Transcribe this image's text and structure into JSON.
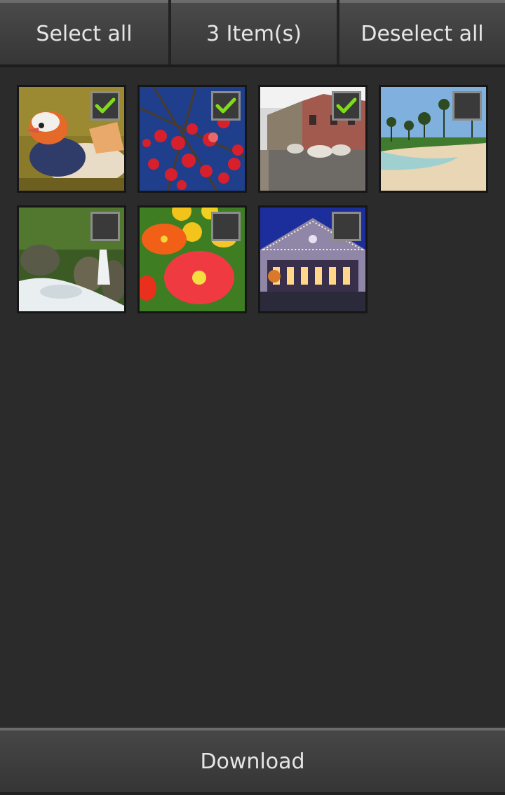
{
  "toolbar": {
    "select_all_label": "Select all",
    "count_label": "3 Item(s)",
    "deselect_all_label": "Deselect all"
  },
  "photos": [
    {
      "subject": "mandarin duck",
      "checked": true
    },
    {
      "subject": "red apples on branch",
      "checked": true
    },
    {
      "subject": "street with cattle",
      "checked": true
    },
    {
      "subject": "tropical beach",
      "checked": false
    },
    {
      "subject": "forest waterfall",
      "checked": false
    },
    {
      "subject": "red poppies",
      "checked": false
    },
    {
      "subject": "lit building at night",
      "checked": false
    }
  ],
  "bottom": {
    "download_label": "Download"
  },
  "colors": {
    "check_green": "#7fdc1a",
    "background": "#2b2b2b"
  }
}
